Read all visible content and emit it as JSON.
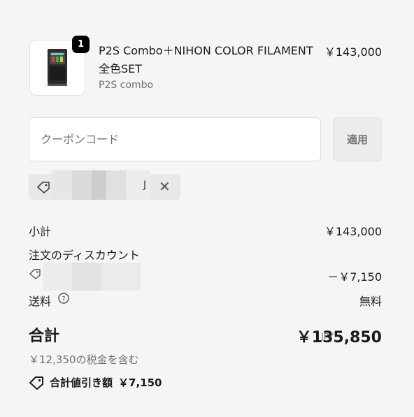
{
  "product": {
    "quantity": "1",
    "name": "P2S Combo＋NIHON COLOR FILAMENT 全色SET",
    "variant": "P2S combo",
    "price": "￥143,000",
    "image_icon": "3d-printer-icon"
  },
  "coupon": {
    "placeholder": "クーポンコード",
    "value": "",
    "apply_label": "適用",
    "applied_code_visible": "J"
  },
  "summary": {
    "subtotal_label": "小計",
    "subtotal_value": "￥143,000",
    "discount_label": "注文のディスカウント",
    "discount_value": "－￥7,150",
    "shipping_label": "送料",
    "shipping_value": "無料"
  },
  "total": {
    "label": "合計",
    "currency": "JPY",
    "value": "￥135,850",
    "tax_note": "￥12,350の税金を含む",
    "savings_label": "合計値引き額",
    "savings_value": "￥7,150"
  }
}
